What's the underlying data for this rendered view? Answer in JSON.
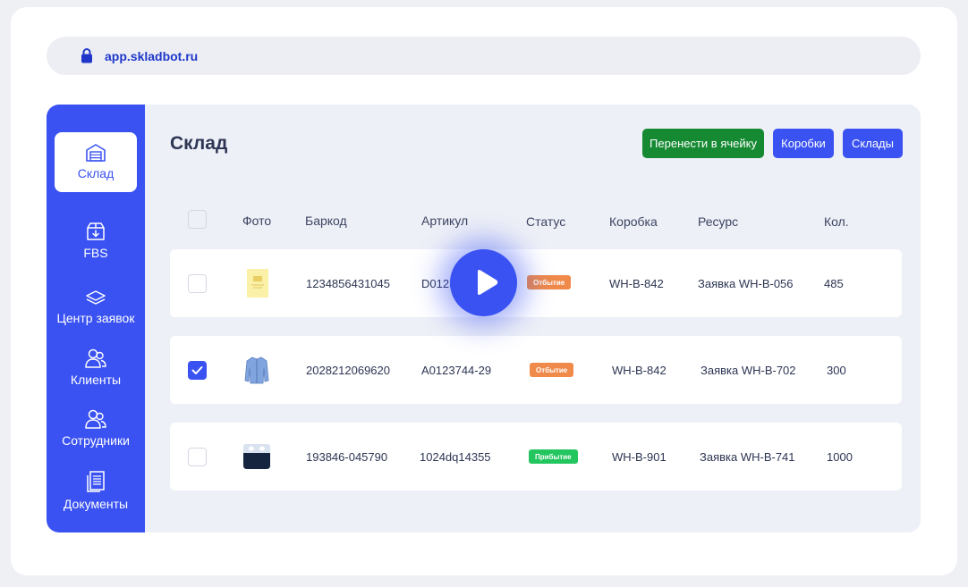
{
  "browser": {
    "url": "app.skladbot.ru"
  },
  "sidebar": {
    "items": [
      {
        "label": "Склад",
        "icon": "warehouse-icon",
        "active": true
      },
      {
        "label": "FBS",
        "icon": "box-download-icon"
      },
      {
        "label": "Центр заявок",
        "icon": "layers-icon"
      },
      {
        "label": "Клиенты",
        "icon": "users-icon"
      },
      {
        "label": "Сотрудники",
        "icon": "employees-icon"
      },
      {
        "label": "Документы",
        "icon": "documents-icon"
      }
    ]
  },
  "page": {
    "title": "Склад"
  },
  "toolbar": {
    "move_label": "Перенести в ячейку",
    "boxes_label": "Коробки",
    "warehouses_label": "Склады"
  },
  "table": {
    "columns": [
      "Фото",
      "Баркод",
      "Артикул",
      "Статус",
      "Коробка",
      "Ресурс",
      "Кол."
    ],
    "rows": [
      {
        "checked": false,
        "photo": "yellow-card-image",
        "barcode": "1234856431045",
        "article": "D0123LLL",
        "status": "Отбытие",
        "status_color": "#f08a4b",
        "box": "WH-B-842",
        "resource": "Заявка WH-B-056",
        "qty": "485"
      },
      {
        "checked": true,
        "photo": "blue-shirt-image",
        "barcode": "2028212069620",
        "article": "A0123744-29",
        "status": "Отбытие",
        "status_color": "#f08a4b",
        "box": "WH-B-842",
        "resource": "Заявка WH-B-702",
        "qty": "300"
      },
      {
        "checked": false,
        "photo": "earbuds-case-image",
        "barcode": "193846-045790",
        "article": "1024dq14355",
        "status": "Прибытие",
        "status_color": "#22c55e",
        "box": "WH-B-901",
        "resource": "Заявка WH-B-741",
        "qty": "1000"
      }
    ]
  },
  "colors": {
    "accent": "#3a52f2",
    "green_button": "#168a33",
    "orange_badge": "#f08a4b",
    "green_badge": "#22c55e"
  }
}
